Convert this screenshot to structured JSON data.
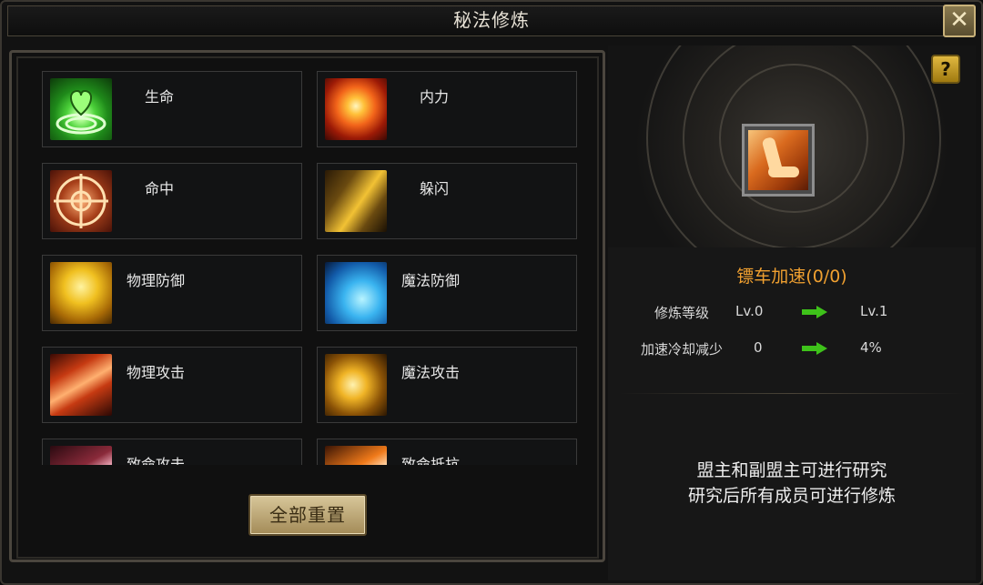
{
  "window": {
    "title": "秘法修炼",
    "close_glyph": "✕"
  },
  "skills": [
    {
      "label": "生命",
      "icon": "heart-icon"
    },
    {
      "label": "内力",
      "icon": "fire-orb-icon"
    },
    {
      "label": "命中",
      "icon": "crosshair-icon"
    },
    {
      "label": "躲闪",
      "icon": "dodge-boot-icon"
    },
    {
      "label": "物理防御",
      "icon": "shield-icon"
    },
    {
      "label": "魔法防御",
      "icon": "magic-shield-icon"
    },
    {
      "label": "物理攻击",
      "icon": "blade-icon"
    },
    {
      "label": "魔法攻击",
      "icon": "magic-swirl-icon"
    },
    {
      "label": "致命攻击",
      "icon": "critical-attack-icon"
    },
    {
      "label": "致命抵抗",
      "icon": "critical-resist-icon"
    }
  ],
  "reset_button": "全部重置",
  "detail": {
    "help_glyph": "?",
    "icon": "speed-foot-icon",
    "title": "镖车加速(0/0)",
    "rows": [
      {
        "label": "修炼等级",
        "current": "Lv.0",
        "next": "Lv.1"
      },
      {
        "label": "加速冷却减少",
        "current": "0",
        "next": "4%"
      }
    ],
    "info_lines": [
      "盟主和副盟主可进行研究",
      "研究后所有成员可进行修炼"
    ]
  },
  "colors": {
    "accent": "#f0a030",
    "arrow": "#3ec21a",
    "gold_button": "#c9b27a"
  }
}
